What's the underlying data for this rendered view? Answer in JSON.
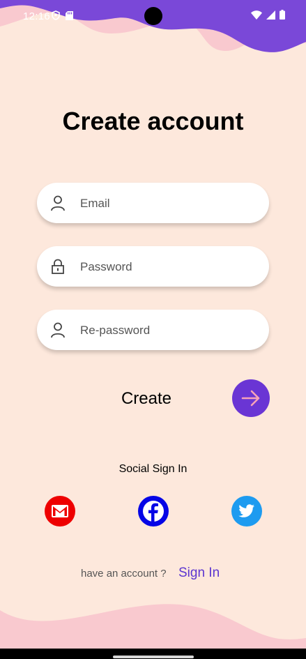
{
  "colors": {
    "background": "#fde8dc",
    "wave_purple": "#7a48d8",
    "wave_pink": "#f9c9cf",
    "accent": "#6a35d4",
    "gmail": "#ee0000",
    "facebook": "#0505e6",
    "twitter": "#1d9bf0"
  },
  "status_bar": {
    "time": "12:16",
    "left_icons": [
      "shield-icon",
      "sd-card-icon"
    ],
    "right_icons": [
      "wifi-icon",
      "signal-icon",
      "battery-icon"
    ]
  },
  "page": {
    "title": "Create account"
  },
  "form": {
    "email_placeholder": "Email",
    "email_value": "",
    "email_icon": "person-icon",
    "password_placeholder": "Password",
    "password_value": "",
    "password_icon": "lock-icon",
    "repassword_placeholder": "Re-password",
    "repassword_value": "",
    "repassword_icon": "person-icon"
  },
  "create": {
    "label": "Create",
    "button_icon": "arrow-right-icon"
  },
  "social": {
    "label": "Social Sign In",
    "providers": [
      "gmail-icon",
      "facebook-icon",
      "twitter-icon"
    ]
  },
  "footer": {
    "prompt": "have an account ?",
    "link": "Sign In"
  }
}
